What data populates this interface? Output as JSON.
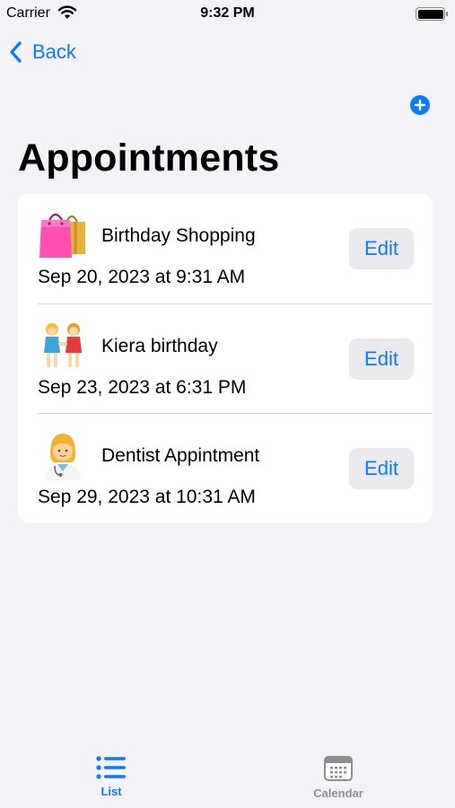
{
  "status_bar": {
    "carrier": "Carrier",
    "time": "9:32 PM"
  },
  "nav": {
    "back_label": "Back",
    "add_icon": "plus-circle-icon"
  },
  "page": {
    "title": "Appointments"
  },
  "appointments": [
    {
      "emoji": "shopping-bags-icon",
      "title": "Birthday Shopping",
      "datetime": "Sep 20, 2023 at 9:31 AM",
      "edit_label": "Edit"
    },
    {
      "emoji": "two-women-holding-hands-icon",
      "title": "Kiera birthday",
      "datetime": "Sep 23, 2023 at 6:31 PM",
      "edit_label": "Edit"
    },
    {
      "emoji": "woman-health-worker-icon",
      "title": "Dentist Appintment",
      "datetime": "Sep 29, 2023 at 10:31 AM",
      "edit_label": "Edit"
    }
  ],
  "tab_bar": {
    "tabs": [
      {
        "label": "List",
        "icon": "list-icon",
        "selected": true
      },
      {
        "label": "Calendar",
        "icon": "calendar-icon",
        "selected": false
      }
    ]
  },
  "colors": {
    "accent": "#0a7aff",
    "background": "#f2f2f7",
    "card": "#ffffff",
    "button_fill": "#e9e9ee",
    "inactive": "#8e8e93"
  }
}
